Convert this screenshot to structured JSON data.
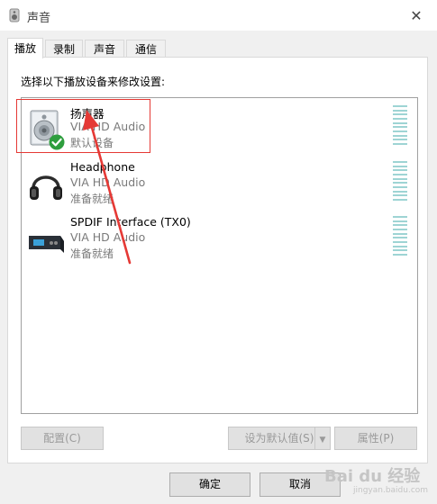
{
  "window": {
    "title": "声音"
  },
  "tabs": [
    {
      "label": "播放",
      "active": true
    },
    {
      "label": "录制",
      "active": false
    },
    {
      "label": "声音",
      "active": false
    },
    {
      "label": "通信",
      "active": false
    }
  ],
  "instruction": "选择以下播放设备来修改设置:",
  "devices": [
    {
      "name": "扬声器",
      "driver": "VIA HD Audio",
      "status": "默认设备",
      "icon": "speaker-icon",
      "is_default": true
    },
    {
      "name": "Headphone",
      "driver": "VIA HD Audio",
      "status": "准备就绪",
      "icon": "headphone-icon",
      "is_default": false
    },
    {
      "name": "SPDIF Interface (TX0)",
      "driver": "VIA HD Audio",
      "status": "准备就绪",
      "icon": "spdif-device-icon",
      "is_default": false
    }
  ],
  "buttons": {
    "configure": "配置(C)",
    "set_default": "设为默认值(S)",
    "properties": "属性(P)",
    "ok": "确定",
    "cancel": "取消"
  },
  "watermark": "Bai du 经验",
  "watermark_url": "jingyan.baidu.com",
  "colors": {
    "highlight": "#e53935",
    "check": "#2e9e3e",
    "level_meter": "#9ed4d4"
  }
}
